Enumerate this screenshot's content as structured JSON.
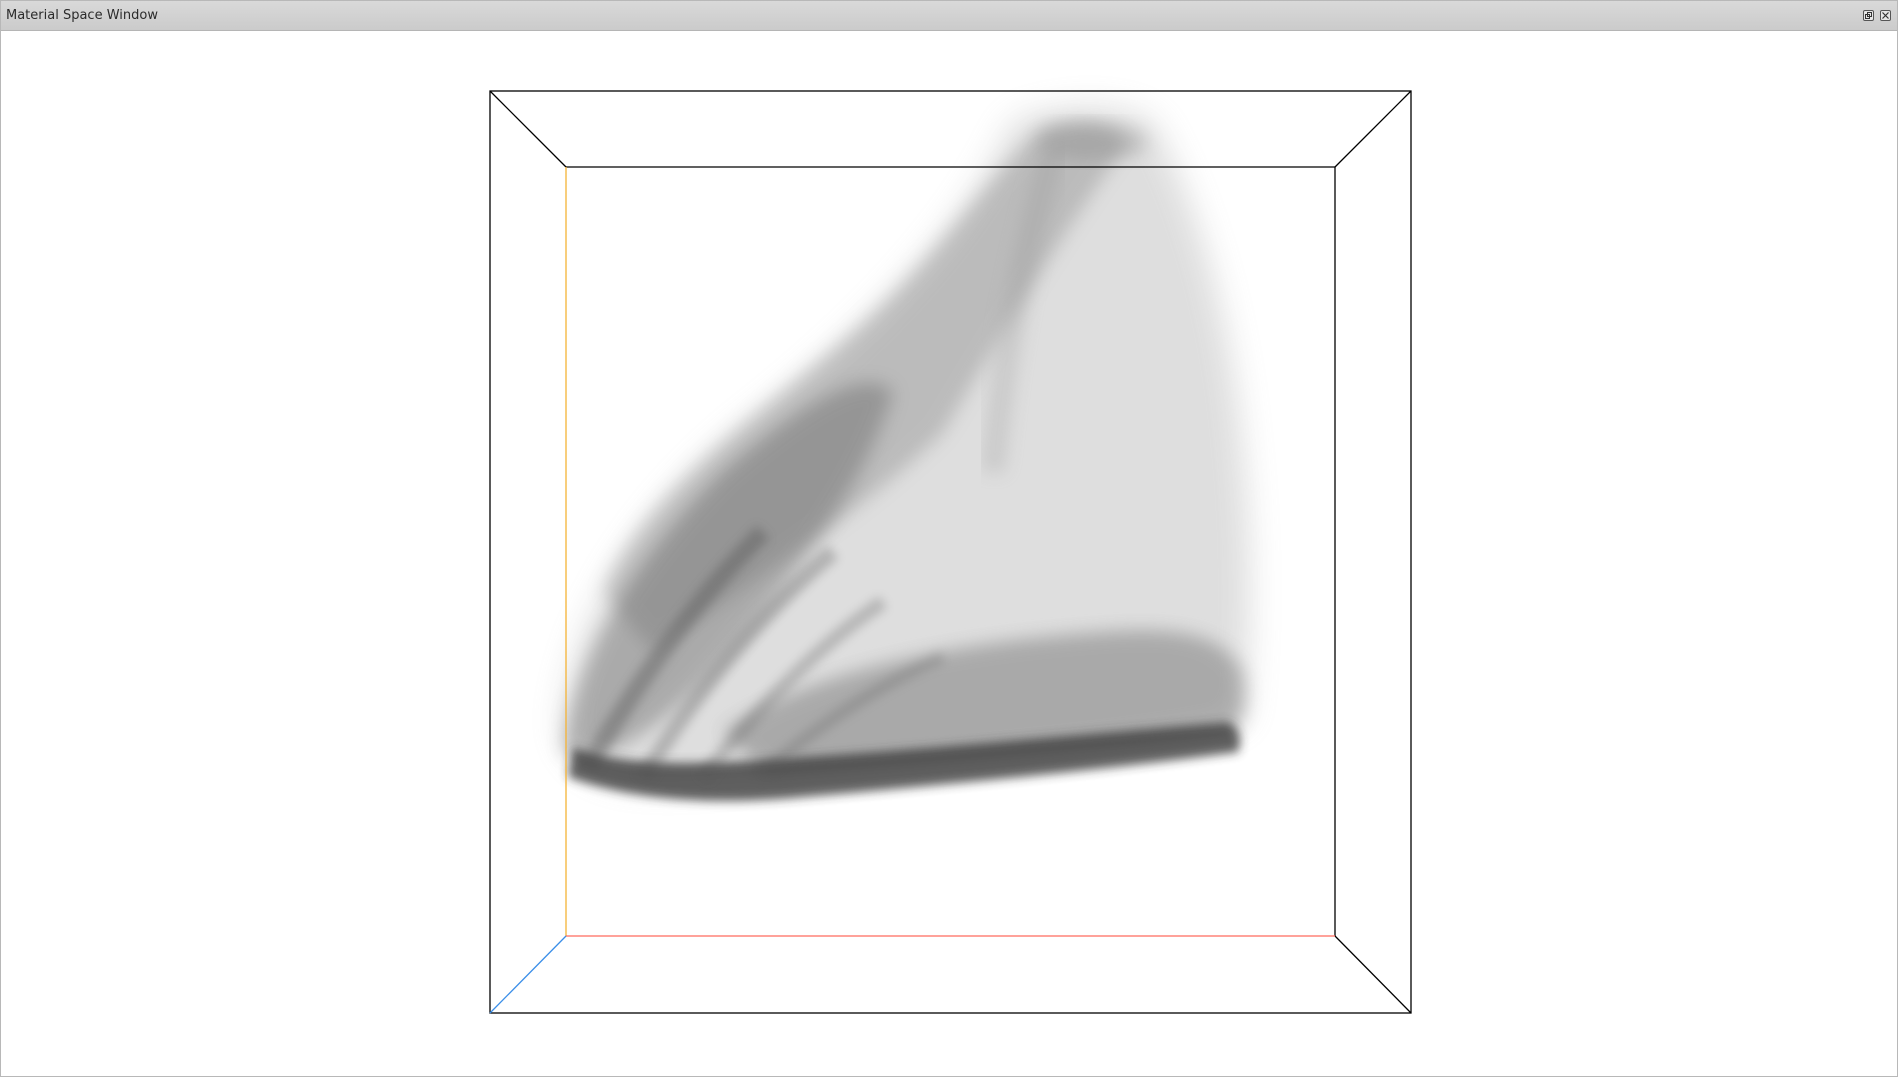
{
  "window": {
    "title": "Material Space Window",
    "float_button_icon": "float-window-icon",
    "close_button_icon": "close-icon"
  },
  "viewport": {
    "background": "#ffffff",
    "box_edge_color": "#000000",
    "axis_colors": {
      "red_axis": "#ff6b5e",
      "yellow_axis": "#f5b335",
      "blue_axis": "#3a8ee8"
    },
    "volume_color": "grayscale"
  }
}
